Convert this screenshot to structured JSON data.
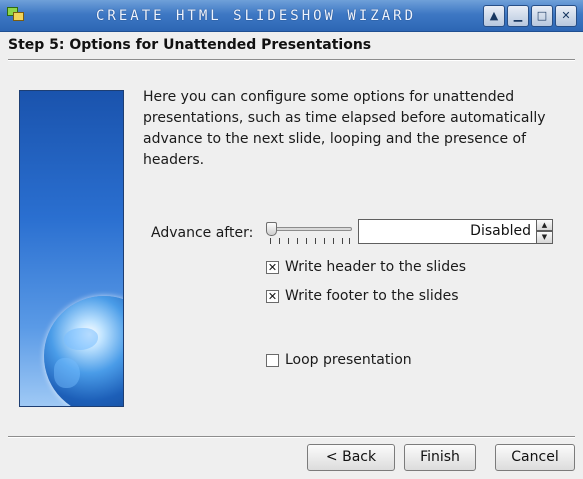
{
  "window": {
    "title": "Create HTML Slideshow Wizard",
    "buttons": {
      "up": "▲",
      "minimize": "▁",
      "maximize": "□",
      "close": "✕"
    }
  },
  "header": {
    "step_title": "Step 5: Options for Unattended Presentations"
  },
  "description": "Here you can configure some options for unattended presentations, such as time elapsed before automatically advance to the next slide, looping and the presence of headers.",
  "advance": {
    "label": "Advance after:",
    "slider_position": 0,
    "value": "Disabled",
    "spin_up": "▲",
    "spin_down": "▼"
  },
  "options": {
    "header": {
      "label": "Write header to the slides",
      "checked": true,
      "mark": "✕"
    },
    "footer": {
      "label": "Write footer to the slides",
      "checked": true,
      "mark": "✕"
    },
    "loop": {
      "label": "Loop presentation",
      "checked": false,
      "mark": ""
    }
  },
  "footer_buttons": {
    "back": "< Back",
    "finish": "Finish",
    "cancel": "Cancel"
  },
  "colors": {
    "titlebar": "#3e78c4",
    "side_image": "#2a6fd0",
    "background": "#efefef"
  },
  "icons": [
    "app-icon",
    "globe-image",
    "shade-icon",
    "minimize-icon",
    "maximize-icon",
    "close-icon"
  ]
}
